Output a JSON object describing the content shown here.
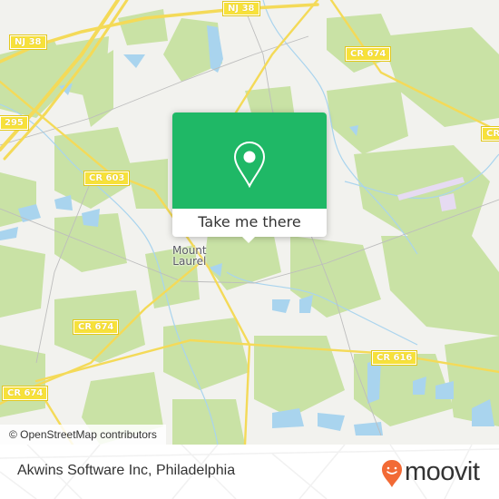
{
  "map": {
    "colors": {
      "land": "#f2f2ee",
      "forest": "#c9e2a5",
      "water": "#a9d4ee",
      "road": "#f4da58",
      "minor_road": "#bdbdbd",
      "airport": "#e6dbf2"
    },
    "road_labels": [
      {
        "id": "nj38-top",
        "text": "NJ 38"
      },
      {
        "id": "nj38-left",
        "text": "NJ 38"
      },
      {
        "id": "i295",
        "text": "295"
      },
      {
        "id": "cr603",
        "text": "CR 603"
      },
      {
        "id": "cr674-top",
        "text": "CR 674"
      },
      {
        "id": "cr674-right",
        "text": "CR"
      },
      {
        "id": "cr674-mid",
        "text": "CR 674"
      },
      {
        "id": "cr674-bottom",
        "text": "CR 674"
      },
      {
        "id": "cr616",
        "text": "CR 616"
      }
    ],
    "place_label": {
      "line1": "Mount",
      "line2": "Laurel"
    },
    "attribution": "© OpenStreetMap contributors"
  },
  "popup": {
    "icon": "map-pin-icon",
    "accent": "#1fb866",
    "button_label": "Take me there"
  },
  "footer": {
    "place_name": "Akwins Software Inc, Philadelphia",
    "brand_name": "moovit",
    "brand_icon": "moovit-smile-pin-icon",
    "brand_color": "#f26a35"
  }
}
